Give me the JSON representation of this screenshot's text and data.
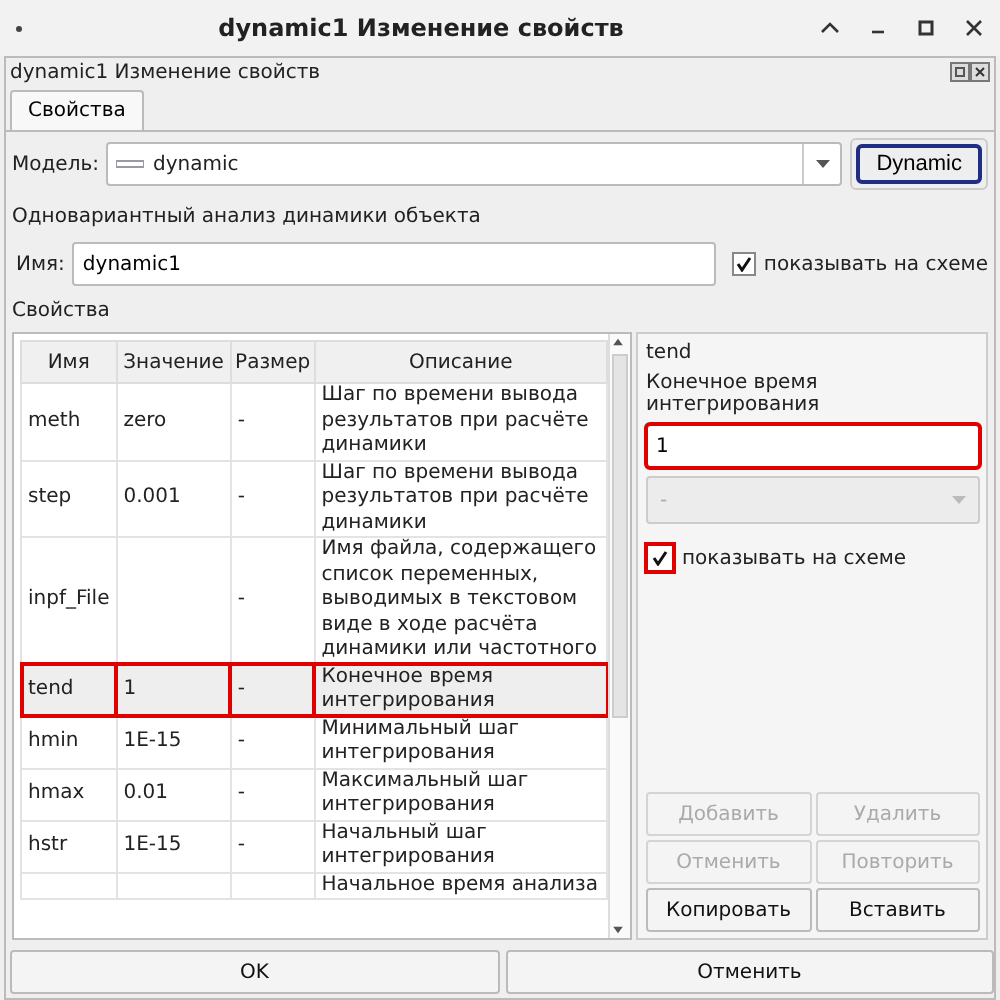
{
  "window": {
    "title": "dynamic1 Изменение свойств"
  },
  "dock": {
    "title": "dynamic1 Изменение свойств"
  },
  "tabs": [
    {
      "label": "Свойства",
      "selected": true
    }
  ],
  "model": {
    "label": "Модель:",
    "value": "dynamic",
    "button": "Dynamic"
  },
  "description": "Одновариантный анализ динамики объекта",
  "name_field": {
    "label": "Имя:",
    "value": "dynamic1",
    "show_checkbox": {
      "label": "показывать на схеме",
      "checked": true
    }
  },
  "properties_label": "Свойства",
  "table": {
    "columns": [
      "Имя",
      "Значение",
      "Размер",
      "Описание"
    ],
    "rows": [
      {
        "name": "meth",
        "value": "zero",
        "size": "-",
        "description": "Шаг по времени вывода результатов при расчёте динамики",
        "selected": false,
        "highlighted": false
      },
      {
        "name": "step",
        "value": "0.001",
        "size": "-",
        "description": "Шаг по времени вывода результатов при расчёте динамики",
        "selected": false,
        "highlighted": false
      },
      {
        "name": "inpf_File",
        "value": "",
        "size": "-",
        "description": "Имя файла, содержащего список переменных, выводимых в текстовом виде в ходе расчёта динамики или частотного",
        "selected": false,
        "highlighted": false
      },
      {
        "name": "tend",
        "value": "1",
        "size": "-",
        "description": "Конечное время интегрирования",
        "selected": true,
        "highlighted": true
      },
      {
        "name": "hmin",
        "value": "1E-15",
        "size": "-",
        "description": "Минимальный  шаг интегрирования",
        "selected": false,
        "highlighted": false
      },
      {
        "name": "hmax",
        "value": "0.01",
        "size": "-",
        "description": "Максимальный  шаг интегрирования",
        "selected": false,
        "highlighted": false
      },
      {
        "name": "hstr",
        "value": "1E-15",
        "size": "-",
        "description": "Начальный шаг интегрирования",
        "selected": false,
        "highlighted": false
      },
      {
        "name": "",
        "value": "",
        "size": "",
        "description": "Начальное время  анализа",
        "selected": false,
        "highlighted": false
      }
    ]
  },
  "editor": {
    "name": "tend",
    "caption": "Конечное время интегрирования",
    "value": "1",
    "value_highlighted": true,
    "unit": "-",
    "unit_disabled": true,
    "show_checkbox": {
      "label": "показывать на схеме",
      "checked": true,
      "highlighted": true
    }
  },
  "edit_buttons": [
    {
      "label": "Добавить",
      "disabled": true
    },
    {
      "label": "Удалить",
      "disabled": true
    },
    {
      "label": "Отменить",
      "disabled": true
    },
    {
      "label": "Повторить",
      "disabled": true
    },
    {
      "label": "Копировать",
      "disabled": false
    },
    {
      "label": "Вставить",
      "disabled": false
    }
  ],
  "dialog_buttons": [
    "OK",
    "Отменить"
  ]
}
